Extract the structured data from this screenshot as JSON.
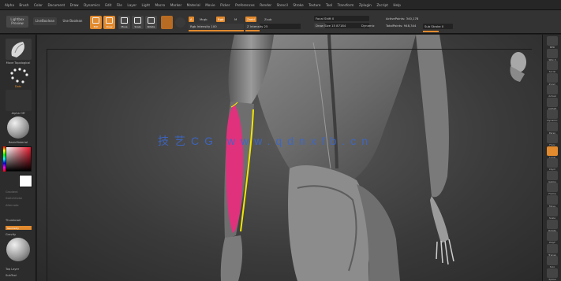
{
  "menu": [
    "Alpha",
    "Brush",
    "Color",
    "Document",
    "Draw",
    "Dynamics",
    "Edit",
    "File",
    "Layer",
    "Light",
    "Macro",
    "Marker",
    "Material",
    "Movie",
    "Picker",
    "Preferences",
    "Render",
    "Stencil",
    "Stroke",
    "Texture",
    "Tool",
    "Transform",
    "Zplugin",
    "Zscript",
    "Help"
  ],
  "toolbar": {
    "lightbox_label_1": "Lightbox",
    "lightbox_label_2": "Preview",
    "liveboolean": "LiveBoolean",
    "edit": "Edit",
    "draw": "Draw",
    "move": "Move",
    "scale": "Scale",
    "rotate": "Rotate",
    "a_chip": "A",
    "mrgb": "Mrgb",
    "rgb": "Rgb",
    "m": "M",
    "zadd": "Zadd",
    "zsub": "Zsub",
    "zcut": "Zcut",
    "rgb_intensity": "Rgb Intensity 100",
    "z_intensity": "Z Intensity 25",
    "focal_shift": "Focal Shift 0",
    "draw_size": "Draw Size 15 87184",
    "dynamic": "Dynamic",
    "active_points": "ActivePoints: 340,178",
    "total_points": "TotalPoints: 948,344",
    "sub_stroke": "Sub Stroke 0"
  },
  "left_panel": {
    "brush_thumb_label": "Move Topological",
    "stroke_label": "Dots",
    "alpha_label": "Alpha Off",
    "material_label": "BasicMaterial",
    "gradient": "Gradient",
    "switch_color": "SwitchColor",
    "alternate": "Alternate",
    "thumbnail": "Thumbnail",
    "geometry": "Geometry",
    "gravity": "Gravity",
    "top_layer": "Top Layer",
    "subtool": "SubTool"
  },
  "right_panel": [
    "BPR",
    "SPix 3",
    "Scroll",
    "Zoom",
    "Actual",
    "AAHalf",
    "Dynamic",
    "Persp",
    "Floor",
    "Local",
    "LSym",
    "Gizmo",
    "Frame",
    "Move",
    "Scale",
    "Rotate",
    "PolyF",
    "Transp",
    "Solo",
    "Xpose"
  ],
  "watermark": "技艺CG  www.qdnxfb.cn",
  "colors": {
    "accent": "#e28a2e",
    "muscle_highlight": "#e0317d",
    "outline": "#f2e600",
    "watermark": "#3b67c9"
  }
}
